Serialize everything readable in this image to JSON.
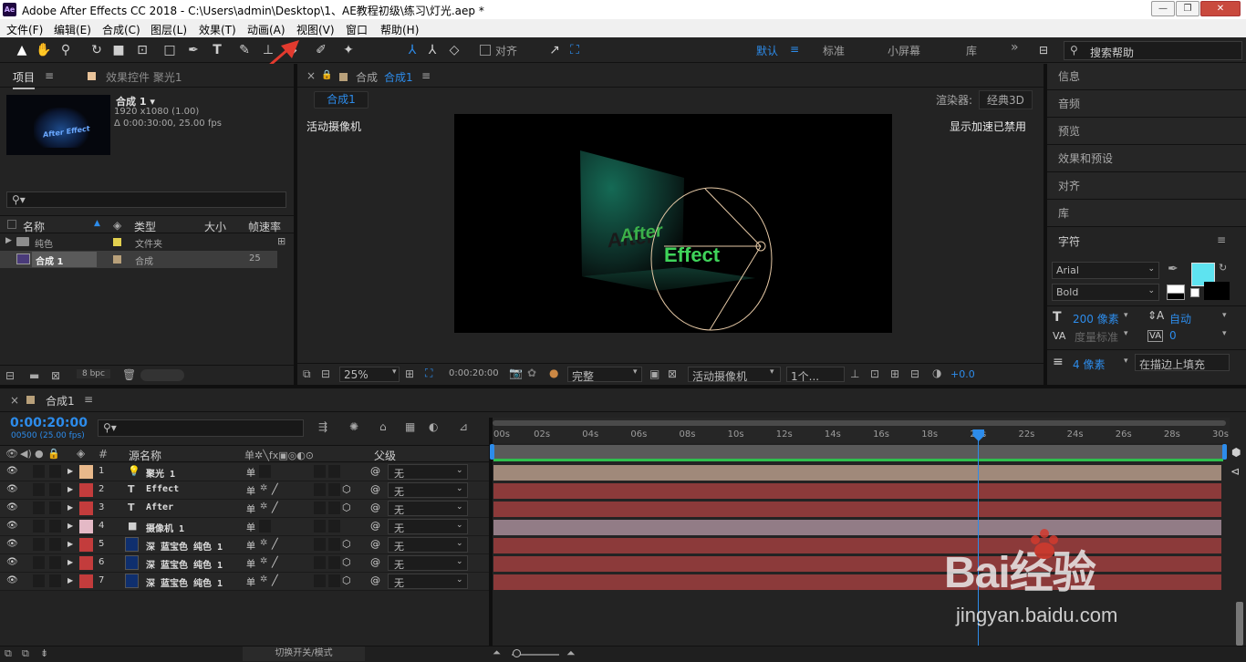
{
  "window": {
    "app_icon": "Ae",
    "title": "Adobe After Effects CC 2018 - C:\\Users\\admin\\Desktop\\1、AE教程初级\\练习\\灯光.aep *"
  },
  "menu": [
    "文件(F)",
    "编辑(E)",
    "合成(C)",
    "图层(L)",
    "效果(T)",
    "动画(A)",
    "视图(V)",
    "窗口",
    "帮助(H)"
  ],
  "toolbar": {
    "align_label": "对齐",
    "workspaces": [
      "默认",
      "标准",
      "小屏幕",
      "库"
    ],
    "more": "»",
    "search_placeholder": "搜索帮助",
    "active_workspace_color": "#2d8ceb"
  },
  "project": {
    "tab_project": "项目",
    "tab_effects": "效果控件 聚光1",
    "comp_name": "合成 1 ▾",
    "comp_res": "1920 x1080 (1.00)",
    "comp_dur": "Δ 0:00:30:00, 25.00 fps",
    "thumb_text": "After Effect",
    "search_placeholder": "",
    "columns": [
      "名称",
      "类型",
      "大小",
      "帧速率"
    ],
    "items": [
      {
        "name": "纯色",
        "type": "文件夹",
        "fps": "",
        "color": "#e2d04f"
      },
      {
        "name": "合成 1",
        "type": "合成",
        "fps": "25",
        "color": "#b8a07a"
      }
    ],
    "bpc": "8 bpc"
  },
  "composition": {
    "tab_label": "合成",
    "tab_name": "合成1",
    "subtab": "合成1",
    "renderer_label": "渲染器:",
    "renderer_value": "经典3D",
    "camera_label": "活动摄像机",
    "accel_label": "显示加速已禁用",
    "scene_text_a": "After",
    "scene_text_b": "Effect",
    "zoom": "25%",
    "timecode": "0:00:20:00",
    "quality": "完整",
    "camera_select": "活动摄像机",
    "views": "1个...",
    "exposure": "+0.0"
  },
  "right_panel": {
    "items": [
      "信息",
      "音频",
      "预览",
      "效果和预设",
      "对齐",
      "库"
    ],
    "character": {
      "title": "字符",
      "font": "Arial",
      "style": "Bold",
      "size": "200 像素",
      "leading": "自动",
      "kerning": "度量标准",
      "tracking": "0",
      "stroke_width": "4 像素",
      "stroke_mode": "在描边上填充",
      "fill_color": "#5ee3f0"
    }
  },
  "timeline": {
    "tab_name": "合成1",
    "timecode": "0:00:20:00",
    "frames": "00500 (25.00 fps)",
    "search_placeholder": "",
    "col_hash": "#",
    "col_source": "源名称",
    "col_parent": "父级",
    "toggle_label": "切换开关/模式",
    "ruler": [
      "00s",
      "02s",
      "04s",
      "06s",
      "08s",
      "10s",
      "12s",
      "14s",
      "16s",
      "18s",
      "20s",
      "22s",
      "24s",
      "26s",
      "28s",
      "30s"
    ],
    "current_time_fraction": 0.6667,
    "layers": [
      {
        "num": "1",
        "kind": "light",
        "name": "聚光 1",
        "color": "#e9b98b",
        "parent": "无",
        "bar": "#a0897a",
        "solid": false,
        "threeD": false
      },
      {
        "num": "2",
        "kind": "text",
        "name": "Effect",
        "color": "#c33c3c",
        "parent": "无",
        "bar": "#8c3a3a",
        "solid": false,
        "threeD": true
      },
      {
        "num": "3",
        "kind": "text",
        "name": "After",
        "color": "#c33c3c",
        "parent": "无",
        "bar": "#8c3a3a",
        "solid": false,
        "threeD": true
      },
      {
        "num": "4",
        "kind": "camera",
        "name": "摄像机 1",
        "color": "#e4b9c6",
        "parent": "无",
        "bar": "#927c86",
        "solid": false,
        "threeD": false
      },
      {
        "num": "5",
        "kind": "solid",
        "name": "深 蓝宝色 纯色 1",
        "color": "#c33c3c",
        "parent": "无",
        "bar": "#8c3a3a",
        "solid": true,
        "threeD": true
      },
      {
        "num": "6",
        "kind": "solid",
        "name": "深 蓝宝色 纯色 1",
        "color": "#c33c3c",
        "parent": "无",
        "bar": "#8c3a3a",
        "solid": true,
        "threeD": true
      },
      {
        "num": "7",
        "kind": "solid",
        "name": "深 蓝宝色 纯色 1",
        "color": "#c33c3c",
        "parent": "无",
        "bar": "#8c3a3a",
        "solid": true,
        "threeD": true
      }
    ]
  },
  "watermark": {
    "brand": "Bai经验",
    "url": "jingyan.baidu.com"
  }
}
